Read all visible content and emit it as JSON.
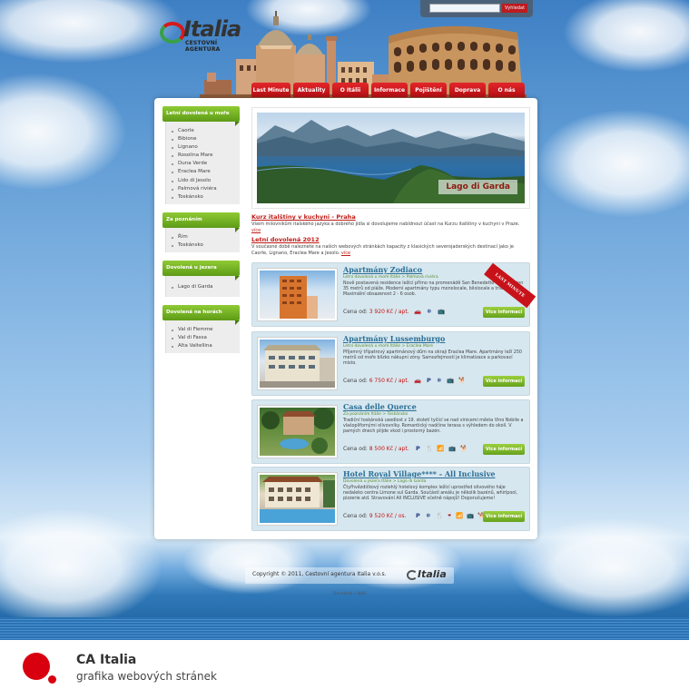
{
  "header": {
    "logo_word": "Italia",
    "logo_sub": "CESTOVNÍ AGENTURA",
    "search_button": "Vyhledat",
    "search_value": ""
  },
  "nav": [
    "Last Minute",
    "Aktuality",
    "O Itálii",
    "Informace",
    "Pojištění",
    "Doprava",
    "O nás"
  ],
  "sidebar": [
    {
      "title": "Letní dovolená u moře",
      "items": [
        "Caorle",
        "Bibione",
        "Lignano",
        "Rosolina Mare",
        "Duna Verde",
        "Eraclea Mare",
        "Lido di Jesolo",
        "Palmová riviéra",
        "Toskánsko"
      ]
    },
    {
      "title": "Za poznáním",
      "items": [
        "Řím",
        "Toskánsko"
      ]
    },
    {
      "title": "Dovolená u jezera",
      "items": [
        "Lago di Garda"
      ]
    },
    {
      "title": "Dovolená na horách",
      "items": [
        "Val di Fiemme",
        "Val di Fassa",
        "Alta Valtellina"
      ]
    }
  ],
  "hero": {
    "caption": "Lago di Garda"
  },
  "news": [
    {
      "title": "Kurz italštiny v kuchyni - Praha",
      "text": "Všem milovníkům italského jazyka a dobrého jídla si dovolujeme nabídnout účast na Kurzu italštiny v kuchyni v Praze.",
      "more": "více"
    },
    {
      "title": "Letní dovolená 2012",
      "text": "V současné době naleznete na našich webových stránkách kapacity z klasických severojaderských destinací jako je Caorle, Lignano, Eraclea Mare a Jesolo.",
      "more": "více"
    }
  ],
  "ribbon": "LAST MINUTE",
  "offers": [
    {
      "title": "Apartmány Zodiaco",
      "breadcrumb": "Letní dovolená u moře Itálie > Palmová riviéra",
      "desc": "Nově postavená residence ležící přímo na promenádě San Benedetto vzdálená jen 35 metrů od pláže. Moderní apartmány typu monolocale, bilolocale a trilocale. Maximální obsazenost 2 - 6 osob.",
      "price_label": "Cena od:",
      "price": "3 920 Kč / apt.",
      "icons": [
        "car-icon",
        "snow-icon",
        "tv-icon"
      ],
      "button": "Více informací"
    },
    {
      "title": "Apartmány Lussemburgo",
      "breadcrumb": "Letní dovolená u moře Itálie > Eraclea Mare",
      "desc": "Příjemný třípatrový apartmánový dům na okraji Eraclea Mare. Apartmány leží 250 metrů od moře blízko nákupní zóny. Samozřejmostí je klimatizace a parkovací místo.",
      "price_label": "Cena od:",
      "price": "6 750 Kč / apt.",
      "icons": [
        "car-icon",
        "parking-icon",
        "snow-icon",
        "tv-icon",
        "pet-icon"
      ],
      "button": "Více informací"
    },
    {
      "title": "Casa delle Querce",
      "breadcrumb": "Za poznáním Itálie > Toskánsko",
      "desc": "Tradiční toskánská usedlost z 19. století tyčící se nad vinicemi města Vino Nobile a vlašoplifornými olivovníky. Romantický nadčine terasa s výhledem do okolí. V pamých dnech plijde vkod i prostorný bazén.",
      "price_label": "Cena od:",
      "price": "8 500 Kč / apt.",
      "icons": [
        "parking-icon",
        "restaurant-icon",
        "wifi-icon",
        "tv-icon",
        "pet-icon"
      ],
      "button": "Více informací"
    },
    {
      "title": "Hotel Royal Village**** - All Inclusive",
      "breadcrumb": "Dovolená u jezera Itálie > Lago di Garda",
      "desc": "Čtyřhvězdičkový rozlehlý hotelový komplex ležící uprostřed olivového háje nedaleko centra Limone sul Garda. Součástí areálu je několik bazénů, whirlpool, pizzerie atd. Stravování All INCLUSIVE včetně nápojů! Doporučujeme!",
      "price_label": "Cena od:",
      "price": "9 520 Kč / os.",
      "icons": [
        "parking-icon",
        "snow-icon",
        "restaurant-icon",
        "bar-icon",
        "wifi-icon",
        "tv-icon",
        "pet-icon"
      ],
      "button": "Více informací"
    }
  ],
  "footer": {
    "copyright": "Copyright © 2011, Cestovní agentura Italia v.o.s.",
    "logo_word": "Italia",
    "breadcrumb": "Dovolená » Itálii"
  },
  "caption": {
    "title": "CA Italia",
    "subtitle": "grafika webových stránek"
  },
  "colors": {
    "brand_red": "#c71313",
    "brand_green": "#6aa51e",
    "offer_bg": "#d6e7ef",
    "sky": "#5c99d3"
  }
}
